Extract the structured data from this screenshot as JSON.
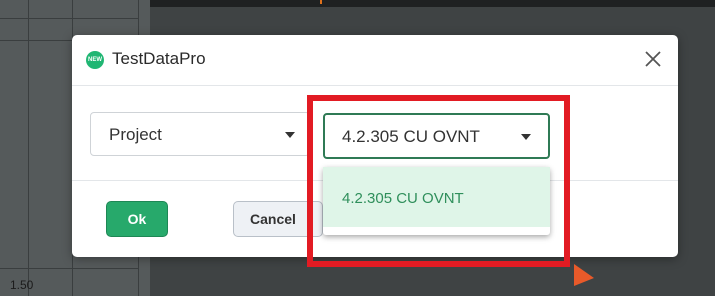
{
  "background": {
    "axis_value": "1.50",
    "accent_color": "#e0711c"
  },
  "dialog": {
    "logo": {
      "text": "NEW",
      "color": "#20b673"
    },
    "title": "TestDataPro",
    "close_icon": "close-icon",
    "project_select": {
      "selected": "Project",
      "icon": "caret-down-icon"
    },
    "version_select": {
      "selected": "4.2.305 CU OVNT",
      "icon": "caret-down-icon",
      "border_color": "#2f7a55"
    },
    "version_dropdown": {
      "options": [
        "4.2.305 CU OVNT"
      ],
      "highlight_color": "#dff5e8"
    },
    "ok_button": {
      "label": "Ok",
      "color": "#27a96b"
    },
    "cancel_button": {
      "label": "Cancel"
    }
  },
  "annotation": {
    "highlight_color": "#e21b23"
  }
}
